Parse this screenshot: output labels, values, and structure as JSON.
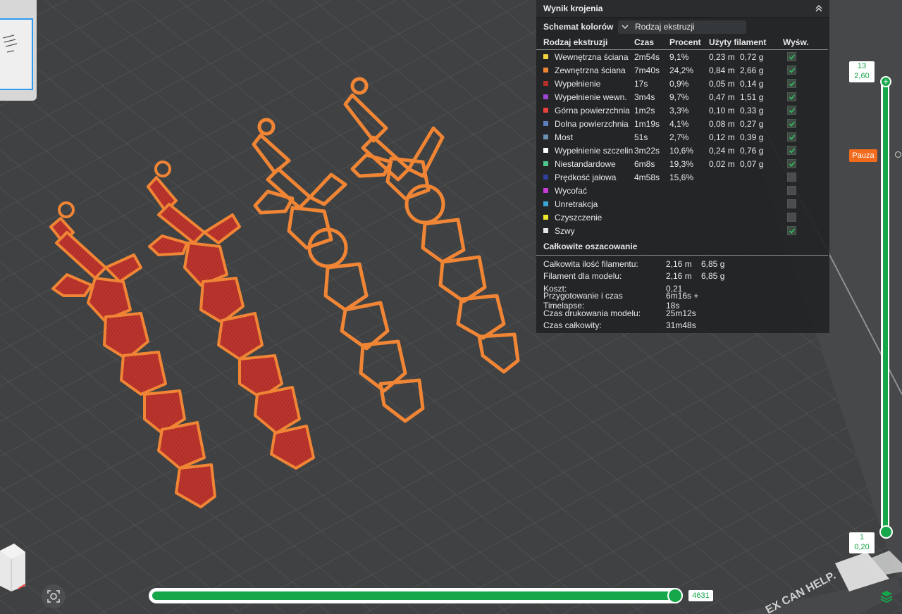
{
  "panel": {
    "title": "Wynik krojenia",
    "scheme_label": "Schemat kolorów",
    "scheme_value": "Rodzaj ekstruzji",
    "headers": {
      "type": "Rodzaj ekstruzji",
      "time": "Czas",
      "percent": "Procent",
      "filament": "Użyty filament",
      "show": "Wyśw."
    },
    "rows": [
      {
        "name": "Wewnętrzna ściana",
        "color": "#f3d33c",
        "time": "2m54s",
        "percent": "9,1%",
        "length": "0,23 m",
        "weight": "0,72 g",
        "shown": true
      },
      {
        "name": "Zewnętrzna ściana",
        "color": "#f08535",
        "time": "7m40s",
        "percent": "24,2%",
        "length": "0,84 m",
        "weight": "2,66 g",
        "shown": true
      },
      {
        "name": "Wypełnienie",
        "color": "#b3302a",
        "time": "17s",
        "percent": "0,9%",
        "length": "0,05 m",
        "weight": "0,14 g",
        "shown": true
      },
      {
        "name": "Wypełnienie wewn.",
        "color": "#9a46cf",
        "time": "3m4s",
        "percent": "9,7%",
        "length": "0,47 m",
        "weight": "1,51 g",
        "shown": true
      },
      {
        "name": "Górna powierzchnia",
        "color": "#e8413b",
        "time": "1m2s",
        "percent": "3,3%",
        "length": "0,10 m",
        "weight": "0,33 g",
        "shown": true
      },
      {
        "name": "Dolna powierzchnia",
        "color": "#5d7ebf",
        "time": "1m19s",
        "percent": "4,1%",
        "length": "0,08 m",
        "weight": "0,27 g",
        "shown": true
      },
      {
        "name": "Most",
        "color": "#6a90b4",
        "time": "51s",
        "percent": "2,7%",
        "length": "0,12 m",
        "weight": "0,39 g",
        "shown": true
      },
      {
        "name": "Wypełnienie szczelin",
        "color": "#ffffff",
        "time": "3m22s",
        "percent": "10,6%",
        "length": "0,24 m",
        "weight": "0,76 g",
        "shown": true
      },
      {
        "name": "Niestandardowe",
        "color": "#4cc88c",
        "time": "6m8s",
        "percent": "19,3%",
        "length": "0,02 m",
        "weight": "0,07 g",
        "shown": true
      },
      {
        "name": "Prędkość jałowa",
        "color": "#2f3f9c",
        "time": "4m58s",
        "percent": "15,6%",
        "length": "",
        "weight": "",
        "shown": false
      },
      {
        "name": "Wycofać",
        "color": "#c83ad4",
        "time": "",
        "percent": "",
        "length": "",
        "weight": "",
        "shown": false
      },
      {
        "name": "Unretrakcja",
        "color": "#3aa6d2",
        "time": "",
        "percent": "",
        "length": "",
        "weight": "",
        "shown": false
      },
      {
        "name": "Czyszczenie",
        "color": "#f0e82a",
        "time": "",
        "percent": "",
        "length": "",
        "weight": "",
        "shown": false
      },
      {
        "name": "Szwy",
        "color": "#e6e6e6",
        "time": "",
        "percent": "",
        "length": "",
        "weight": "",
        "shown": true
      }
    ],
    "summary_title": "Całkowite oszacowanie",
    "summary": [
      {
        "label": "Całkowita ilość filamentu:",
        "a": "2,16 m",
        "b": "6,85 g"
      },
      {
        "label": "Filament dla modelu:",
        "a": "2,16 m",
        "b": "6,85 g"
      },
      {
        "label": "Koszt:",
        "a": "0,21",
        "b": ""
      },
      {
        "label": "Przygotowanie i czas Timelapse:",
        "a": "6m16s + 18s",
        "b": ""
      },
      {
        "label": "Czas drukowania modelu:",
        "a": "25m12s",
        "b": ""
      },
      {
        "label": "Czas całkowity:",
        "a": "31m48s",
        "b": ""
      }
    ]
  },
  "layer_slider": {
    "top_layer": "13",
    "top_height": "2,60",
    "bottom_layer": "1",
    "bottom_height": "0,20",
    "pause_label": "Pauza"
  },
  "move_slider": {
    "value": "4631",
    "fraction": 1.0
  },
  "bed_text": "EX CAN HELP.",
  "colors": {
    "accent": "#17a74b",
    "pause": "#f26b1d",
    "bed": "#3f4143",
    "panel_bg": "#222426"
  }
}
